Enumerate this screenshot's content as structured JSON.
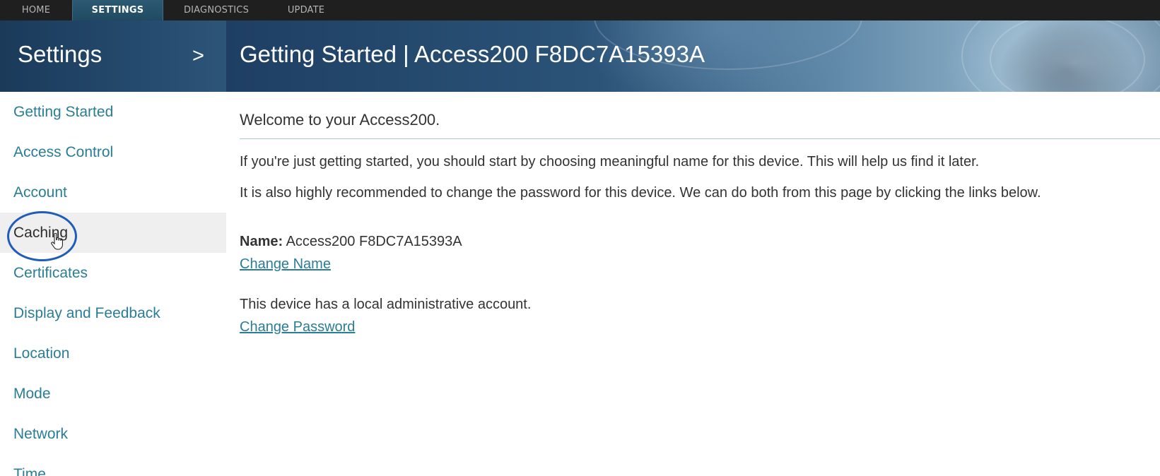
{
  "topnav": {
    "tabs": [
      {
        "label": "HOME"
      },
      {
        "label": "SETTINGS"
      },
      {
        "label": "DIAGNOSTICS"
      },
      {
        "label": "UPDATE"
      }
    ],
    "active_tab": "SETTINGS"
  },
  "sidebar_header": {
    "title": "Settings",
    "toggle_glyph": ">"
  },
  "page_header": {
    "title": "Getting Started | Access200 F8DC7A15393A"
  },
  "sidebar": {
    "items": [
      {
        "label": "Getting Started"
      },
      {
        "label": "Access Control"
      },
      {
        "label": "Account"
      },
      {
        "label": "Caching"
      },
      {
        "label": "Certificates"
      },
      {
        "label": "Display and Feedback"
      },
      {
        "label": "Location"
      },
      {
        "label": "Mode"
      },
      {
        "label": "Network"
      },
      {
        "label": "Time"
      }
    ],
    "active_item": "Caching"
  },
  "content": {
    "welcome": "Welcome to your Access200.",
    "paragraph1": "If you're just getting started, you should start by choosing meaningful name for this device. This will help us find it later.",
    "paragraph2": "It is also highly recommended to change the password for this device. We can do both from this page by clicking the links below.",
    "name_label": "Name:",
    "name_value": "Access200 F8DC7A15393A",
    "change_name_link": "Change Name",
    "account_text": "This device has a local administrative account.",
    "change_password_link": "Change Password"
  },
  "colors": {
    "topbar": "#1f1f1f",
    "active_tab": "#2c5a72",
    "link": "#2a7d96",
    "highlight_circle": "#1f5db8",
    "active_item_bg": "#efefef"
  },
  "icons": {
    "cursor": "hand-pointer-icon"
  }
}
